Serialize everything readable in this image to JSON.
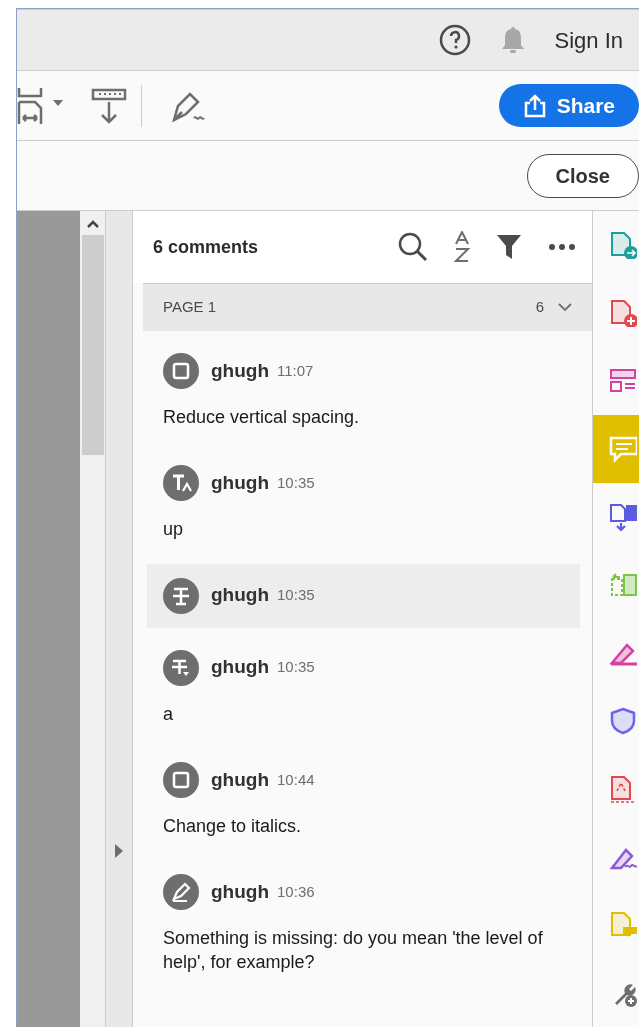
{
  "title_bar": {
    "sign_in": "Sign In"
  },
  "toolbar": {
    "share": "Share"
  },
  "close_button": "Close",
  "comments_panel": {
    "count": "6 comments",
    "page_group": {
      "label": "PAGE 1",
      "count": "6",
      "expanded": true
    },
    "comments": [
      {
        "kind": "note",
        "author": "ghugh",
        "time": "11:07",
        "text": "Reduce vertical spacing.",
        "selected": false
      },
      {
        "kind": "insert",
        "author": "ghugh",
        "time": "10:35",
        "text": "up",
        "selected": false
      },
      {
        "kind": "strike",
        "author": "ghugh",
        "time": "10:35",
        "selected": true
      },
      {
        "kind": "replace",
        "author": "ghugh",
        "time": "10:35",
        "text": "a",
        "selected": false
      },
      {
        "kind": "note",
        "author": "ghugh",
        "time": "10:44",
        "text": "Change to italics.",
        "selected": false
      },
      {
        "kind": "pencil",
        "author": "ghugh",
        "time": "10:36",
        "text": "Something is missing: do you mean 'the level of help', for example?",
        "selected": false
      }
    ]
  },
  "tool_rail": [
    {
      "kind": "export",
      "color": "#1f9e9e",
      "selected": false
    },
    {
      "kind": "create",
      "color": "#e34850",
      "selected": false
    },
    {
      "kind": "organize",
      "color": "#d6409f",
      "selected": false
    },
    {
      "kind": "comment",
      "color": "#ffffff",
      "selected": true
    },
    {
      "kind": "combine",
      "color": "#5c5ce0",
      "selected": false
    },
    {
      "kind": "pages",
      "color": "#7cc44a",
      "selected": false
    },
    {
      "kind": "fill",
      "color": "#d6409f",
      "selected": false
    },
    {
      "kind": "protect",
      "color": "#6767ec",
      "selected": false
    },
    {
      "kind": "stamp",
      "color": "#e34850",
      "selected": false
    },
    {
      "kind": "sign",
      "color": "#9256d9",
      "selected": false
    },
    {
      "kind": "send",
      "color": "#dfbf00",
      "selected": false
    },
    {
      "kind": "tools",
      "color": "#6e6e6e",
      "selected": false
    }
  ]
}
